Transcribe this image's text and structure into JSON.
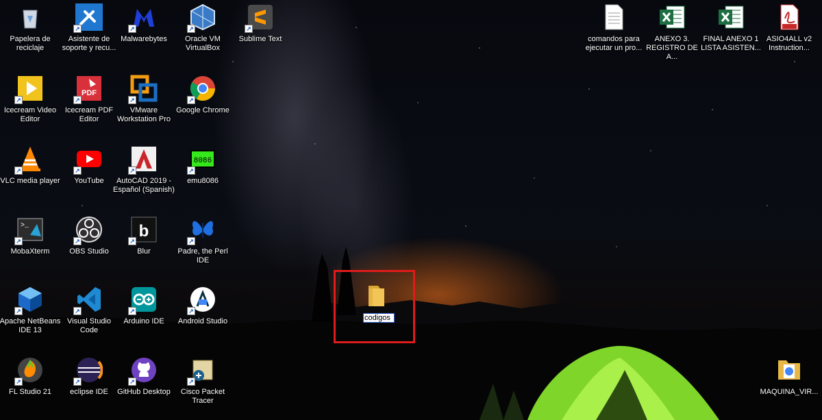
{
  "desktop": {
    "icons": [
      {
        "label": "Papelera de\nreciclaje",
        "icon": "recycle-bin-icon"
      },
      {
        "label": "Asistente de\nsoporte y recu...",
        "icon": "support-assistant-icon"
      },
      {
        "label": "Malwarebytes",
        "icon": "malwarebytes-icon"
      },
      {
        "label": "Oracle VM\nVirtualBox",
        "icon": "virtualbox-icon"
      },
      {
        "label": "Sublime Text",
        "icon": "sublime-text-icon"
      },
      {
        "label": "comandos para\nejecutar un pro...",
        "icon": "text-document-icon"
      },
      {
        "label": "ANEXO 3.\nREGISTRO DE A...",
        "icon": "excel-file-icon"
      },
      {
        "label": "FINAL ANEXO 1\nLISTA ASISTEN...",
        "icon": "excel-file-icon"
      },
      {
        "label": "ASIO4ALL v2\nInstruction...",
        "icon": "pdf-file-icon"
      },
      {
        "label": "Icecream Video\nEditor",
        "icon": "icecream-video-editor-icon"
      },
      {
        "label": "Icecream PDF\nEditor",
        "icon": "icecream-pdf-editor-icon"
      },
      {
        "label": "VMware\nWorkstation Pro",
        "icon": "vmware-icon"
      },
      {
        "label": "Google Chrome",
        "icon": "chrome-icon"
      },
      {
        "label": "VLC media player",
        "icon": "vlc-icon"
      },
      {
        "label": "YouTube",
        "icon": "youtube-icon"
      },
      {
        "label": "AutoCAD 2019 -\nEspañol (Spanish)",
        "icon": "autocad-icon"
      },
      {
        "label": "emu8086",
        "icon": "emu8086-icon"
      },
      {
        "label": "MobaXterm",
        "icon": "mobaxterm-icon"
      },
      {
        "label": "OBS Studio",
        "icon": "obs-icon"
      },
      {
        "label": "Blur",
        "icon": "blur-icon"
      },
      {
        "label": "Padre, the Perl\nIDE",
        "icon": "padre-butterfly-icon"
      },
      {
        "label": "Apache NetBeans\nIDE 13",
        "icon": "netbeans-icon"
      },
      {
        "label": "Visual Studio\nCode",
        "icon": "vscode-icon"
      },
      {
        "label": "Arduino IDE",
        "icon": "arduino-icon"
      },
      {
        "label": "Android Studio",
        "icon": "android-studio-icon"
      },
      {
        "label": "FL Studio 21",
        "icon": "fl-studio-icon"
      },
      {
        "label": "eclipse IDE",
        "icon": "eclipse-icon"
      },
      {
        "label": "GitHub Desktop",
        "icon": "github-icon"
      },
      {
        "label": "Cisco Packet\nTracer",
        "icon": "packet-tracer-icon"
      },
      {
        "label": "MAQUINA_VIR...",
        "icon": "folder-with-file-icon"
      }
    ],
    "new_folder": {
      "name_value": "codigos",
      "icon": "folder-icon"
    },
    "shortcut_arrow": "↗",
    "highlight_color": "#e01b1b"
  }
}
